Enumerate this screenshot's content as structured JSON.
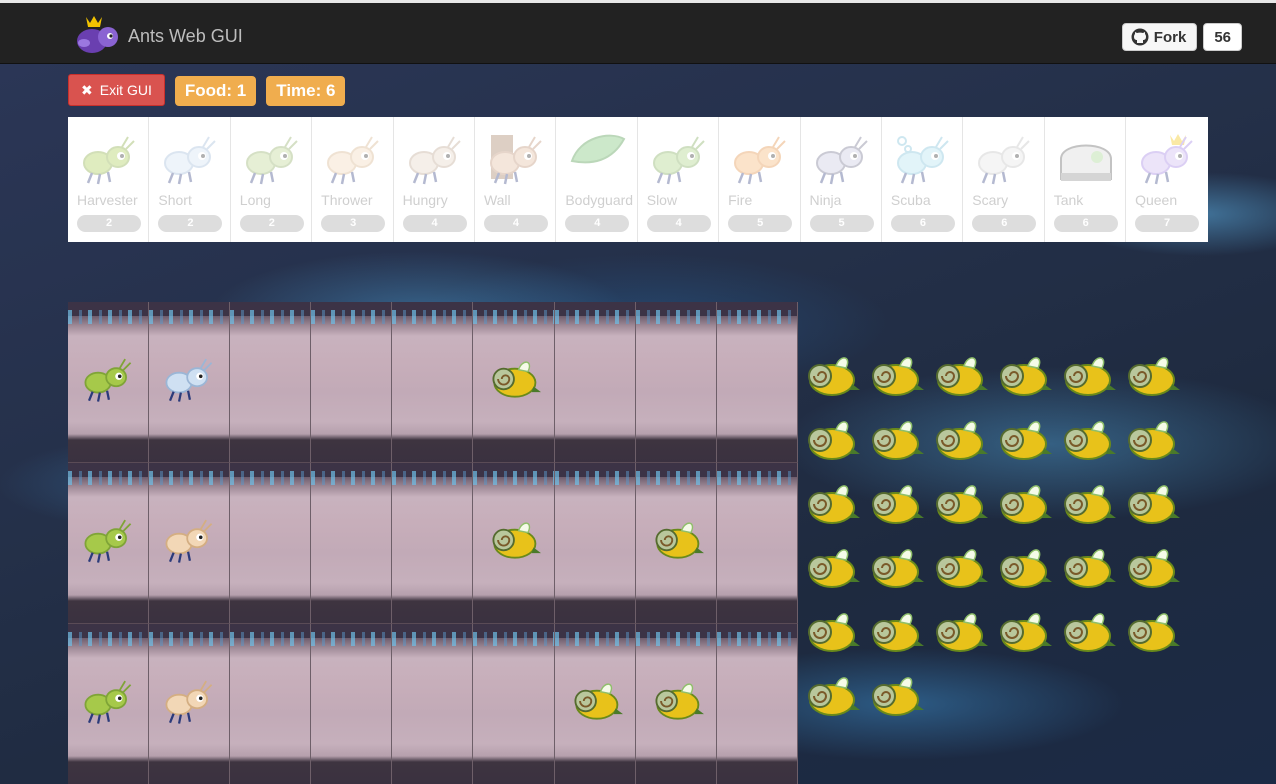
{
  "app": {
    "title": "Ants Web GUI"
  },
  "github": {
    "fork_label": "Fork",
    "fork_count": "56"
  },
  "controls": {
    "exit_label": "Exit GUI",
    "food_label": "Food: 1",
    "time_label": "Time: 6"
  },
  "ant_types": [
    {
      "name": "Harvester",
      "cost": "2",
      "kind": "harvester"
    },
    {
      "name": "Short",
      "cost": "2",
      "kind": "short"
    },
    {
      "name": "Long",
      "cost": "2",
      "kind": "long"
    },
    {
      "name": "Thrower",
      "cost": "3",
      "kind": "thrower"
    },
    {
      "name": "Hungry",
      "cost": "4",
      "kind": "hungry"
    },
    {
      "name": "Wall",
      "cost": "4",
      "kind": "wall"
    },
    {
      "name": "Bodyguard",
      "cost": "4",
      "kind": "bodyguard"
    },
    {
      "name": "Slow",
      "cost": "4",
      "kind": "slow"
    },
    {
      "name": "Fire",
      "cost": "5",
      "kind": "fire"
    },
    {
      "name": "Ninja",
      "cost": "5",
      "kind": "ninja"
    },
    {
      "name": "Scuba",
      "cost": "6",
      "kind": "scuba"
    },
    {
      "name": "Scary",
      "cost": "6",
      "kind": "scary"
    },
    {
      "name": "Tank",
      "cost": "6",
      "kind": "tank"
    },
    {
      "name": "Queen",
      "cost": "7",
      "kind": "queen"
    }
  ],
  "board": {
    "rows": 3,
    "cols": 9,
    "units": [
      {
        "row": 0,
        "col": 0,
        "type": "harvester-ant"
      },
      {
        "row": 0,
        "col": 1,
        "type": "short-thrower-ant"
      },
      {
        "row": 0,
        "col": 5,
        "type": "bee"
      },
      {
        "row": 1,
        "col": 0,
        "type": "harvester-ant"
      },
      {
        "row": 1,
        "col": 1,
        "type": "thrower-ant"
      },
      {
        "row": 1,
        "col": 5,
        "type": "bee"
      },
      {
        "row": 1,
        "col": 7,
        "type": "bee"
      },
      {
        "row": 2,
        "col": 0,
        "type": "harvester-ant"
      },
      {
        "row": 2,
        "col": 1,
        "type": "thrower-ant"
      },
      {
        "row": 2,
        "col": 6,
        "type": "bee"
      },
      {
        "row": 2,
        "col": 7,
        "type": "bee"
      }
    ]
  },
  "hive": {
    "bee_count": 32,
    "columns": 6
  },
  "colors": {
    "exit": "#d9534f",
    "stat": "#f0ad4e",
    "topbar": "#222222"
  }
}
